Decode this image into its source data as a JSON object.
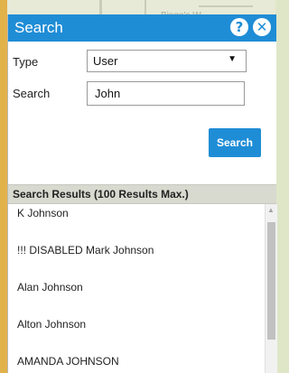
{
  "map": {
    "label": "Bingo's W"
  },
  "header": {
    "title": "Search",
    "help_icon": "?",
    "close_icon": "✕",
    "color": "#1f8dd6"
  },
  "form": {
    "type_label": "Type",
    "type_value": "User",
    "search_label": "Search",
    "search_value": "John",
    "search_button": "Search"
  },
  "results": {
    "header": "Search Results (100 Results Max.)",
    "items": [
      "K Johnson",
      "!!! DISABLED Mark Johnson",
      "Alan Johnson",
      "Alton Johnson",
      "AMANDA JOHNSON"
    ]
  }
}
